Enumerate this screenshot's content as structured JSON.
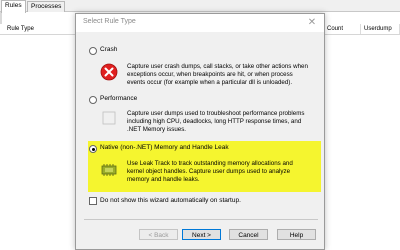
{
  "app": {
    "tabs": [
      {
        "label": "Rules"
      },
      {
        "label": "Processes"
      }
    ],
    "columns": {
      "rule_type": "Rule Type",
      "count": "Count",
      "userdump_path": "Userdump Pa"
    }
  },
  "dialog": {
    "title": "Select Rule Type",
    "close_glyph": "✕",
    "options": [
      {
        "label": "Crash",
        "description": "Capture user crash dumps, call stacks, or take other actions when exceptions occur, when breakpoints are hit, or when process events occur (for example when a particular dll is unloaded).",
        "icon": "crash-error-icon",
        "selected": false
      },
      {
        "label": "Performance",
        "description": "Capture user dumps used to troubleshoot performance problems including high CPU, deadlocks, long HTTP response times, and .NET Memory issues.",
        "icon": "performance-icon",
        "selected": false
      },
      {
        "label": "Native (non-.NET) Memory and Handle Leak",
        "description": "Use Leak Track to track outstanding memory allocations and kernel object handles. Capture user dumps used to analyze memory and handle leaks.",
        "icon": "memory-chip-icon",
        "selected": true
      }
    ],
    "checkbox": {
      "label": "Do not show this wizard automatically on startup.",
      "checked": false
    },
    "buttons": {
      "back": "< Back",
      "next": "Next >",
      "cancel": "Cancel",
      "help": "Help"
    }
  },
  "colors": {
    "highlight": "#f5f52f",
    "error_red": "#e02020",
    "chip_green": "#7a8f1f",
    "window_bg": "#f0f0f0"
  }
}
